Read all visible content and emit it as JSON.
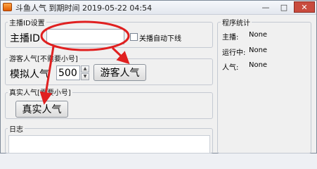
{
  "title": "斗鱼人气 到期时间 2019-05-22 04:54",
  "window_controls": {
    "min": "—",
    "max": "□",
    "close": "✕"
  },
  "anchor_group": {
    "legend": "主播ID设置",
    "label": "主播ID",
    "input_value": "",
    "checkbox_label": "关播自动下线"
  },
  "guest_group": {
    "legend": "游客人气[不需要小号]",
    "label": "模拟人气",
    "spin_value": "500",
    "button": "游客人气"
  },
  "real_group": {
    "legend": "真实人气[需要小号]",
    "button": "真实人气"
  },
  "log_group": {
    "legend": "日志"
  },
  "stats_group": {
    "legend": "程序统计",
    "rows": [
      {
        "label": "主播:",
        "value": "None"
      },
      {
        "label": "运行中:",
        "value": "None"
      },
      {
        "label": "人气:",
        "value": "None"
      }
    ]
  },
  "colors": {
    "annotation": "#e02020",
    "close_button": "#c94b3e"
  }
}
